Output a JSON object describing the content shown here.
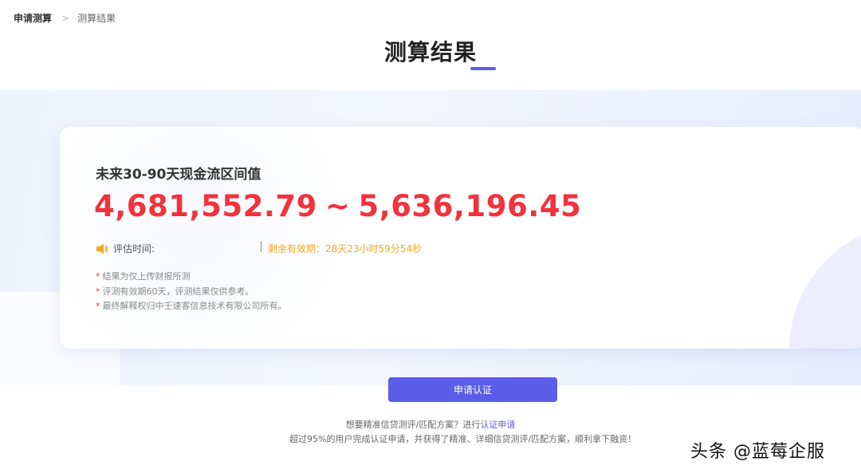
{
  "breadcrumb": {
    "first": "申请测算",
    "separator": ">",
    "current": "测算结果"
  },
  "page_title": "测算结果",
  "result": {
    "label": "未来30-90天现金流区间值",
    "range_low": "4,681,552.79",
    "range_separator": "~",
    "range_high": "5,636,196.45",
    "eval_time_label": "评估时间:",
    "validity_text": "剩余有效期：28天23小时59分54秒"
  },
  "notes": [
    {
      "marker": "*",
      "text": "结果为仅上传财报所测"
    },
    {
      "marker": "*",
      "text": "评测有效期60天，评测结果仅供参考。"
    },
    {
      "marker": "*",
      "text": "最终解释权归中壬速客信息技术有限公司所有。"
    }
  ],
  "apply_button_label": "申请认证",
  "footer": {
    "line1_prefix": "想要精准信贷测评/匹配方案？进行",
    "line1_link": "认证申请",
    "line2": "超过95%的用户完成认证申请，并获得了精准、详细信贷测评/匹配方案，顺利拿下融资！"
  },
  "watermark": "头条 @蓝莓企服",
  "colors": {
    "accent": "#5b5ce8",
    "amount": "#f2323c",
    "validity": "#f5a623"
  },
  "icons": {
    "eval_time": "speaker-icon"
  }
}
